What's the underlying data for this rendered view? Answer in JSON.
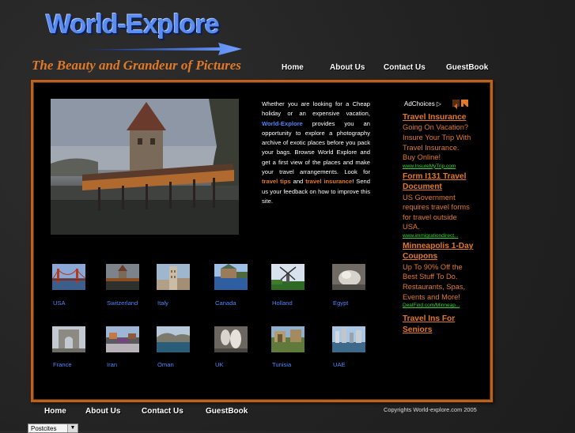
{
  "header": {
    "logo_text": "World-Explore",
    "tagline": "The Beauty and Grandeur of Pictures"
  },
  "top_nav": [
    "Home",
    "About Us",
    "Contact Us",
    "GuestBook"
  ],
  "intro": {
    "p1": "Whether you are looking for a Cheap holiday or an expensive vacation, ",
    "brand": "World-Explore",
    "p2": " provides you an opportunity to explore a photography archive of exotic places before you pack your bags. Browse World Explore and get a first view of the places and make your travel arrangements. Look for ",
    "link1": "travel tips",
    "p3": " and ",
    "link2": "travel insurance",
    "p4": "! Send us your feedback on how to improve this site."
  },
  "ads": {
    "adchoices_label": "AdChoices",
    "items": [
      {
        "title": "Travel Insurance",
        "body": "Going On Vacation? Insure Your Trip With Travel Insurance. Buy Online!",
        "url": "www.InsureMyTrip.com"
      },
      {
        "title": "Form I131 Travel Document",
        "body": "US Government requires travel forms for travel outside USA.",
        "url": "www.immigrationdirect..."
      },
      {
        "title": "Minneapolis 1-Day Coupons",
        "body": "Up To 90% Off the Best Stuff To Do. Restaurants, Spas, Events and More!",
        "url": "DealFind.com/Minneap..."
      },
      {
        "title": "Travel Ins For Seniors",
        "body": "",
        "url": ""
      }
    ]
  },
  "destinations": [
    {
      "name": "USA",
      "icon": "golden-gate-bridge-photo"
    },
    {
      "name": "Switzerland",
      "icon": "chapel-bridge-photo"
    },
    {
      "name": "Italy",
      "icon": "italian-tower-photo"
    },
    {
      "name": "Canada",
      "icon": "canadian-castle-photo"
    },
    {
      "name": "Holland",
      "icon": "windmill-photo"
    },
    {
      "name": "Egypt",
      "icon": "sphinx-photo"
    },
    {
      "name": "France",
      "icon": "arc-de-triomphe-photo"
    },
    {
      "name": "Iran",
      "icon": "iranian-plaza-photo"
    },
    {
      "name": "Oman",
      "icon": "oman-coast-photo"
    },
    {
      "name": "UK",
      "icon": "uk-statue-photo"
    },
    {
      "name": "Tunisia",
      "icon": "tunisia-ruins-photo"
    },
    {
      "name": "UAE",
      "icon": "uae-skyline-photo"
    }
  ],
  "footer": {
    "nav": [
      "Home",
      "About Us",
      "Contact Us",
      "GuestBook"
    ],
    "copyright": "Copyrights World-explore.com 2005"
  },
  "select": {
    "value": "Postcites"
  },
  "colors": {
    "accent_orange": "#e07a2a",
    "link_blue": "#4f86f7",
    "url_green": "#3bd13b",
    "border": "#b8641e"
  }
}
